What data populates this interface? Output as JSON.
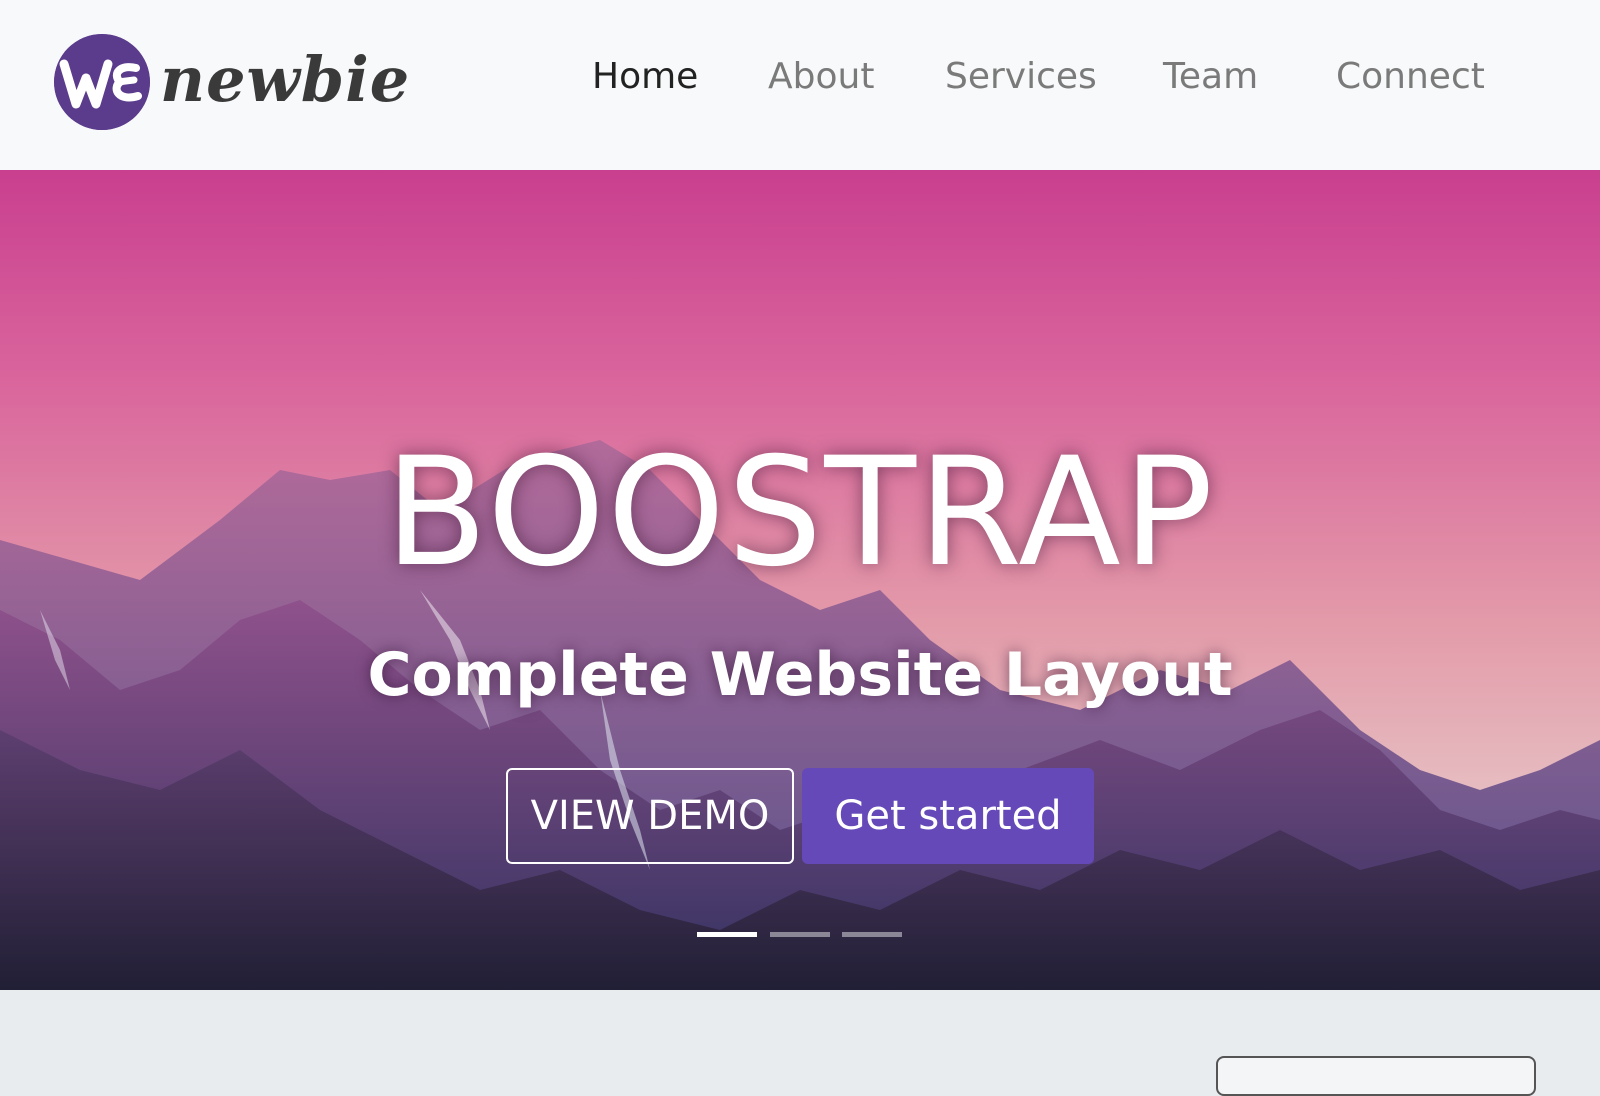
{
  "brand": {
    "mark": "WE",
    "name": "newbie",
    "mark_color": "#5b3c8c"
  },
  "nav": {
    "items": [
      {
        "label": "Home",
        "active": true
      },
      {
        "label": "About",
        "active": false
      },
      {
        "label": "Services",
        "active": false
      },
      {
        "label": "Team",
        "active": false
      },
      {
        "label": "Connect",
        "active": false
      }
    ]
  },
  "hero": {
    "title": "BOOSTRAP",
    "subtitle": "Complete Website Layout",
    "buttons": {
      "demo_label": "VIEW DEMO",
      "start_label": "Get started"
    },
    "indicators": {
      "count": 3,
      "active_index": 0
    }
  },
  "colors": {
    "navbar_bg": "#f8f9fa",
    "primary": "#6549b8",
    "nav_active": "#222222",
    "nav_inactive": "#7a7a7a",
    "page_bg": "#e9ecef"
  },
  "icons": {
    "brand_logo": "brand-logo-icon"
  }
}
